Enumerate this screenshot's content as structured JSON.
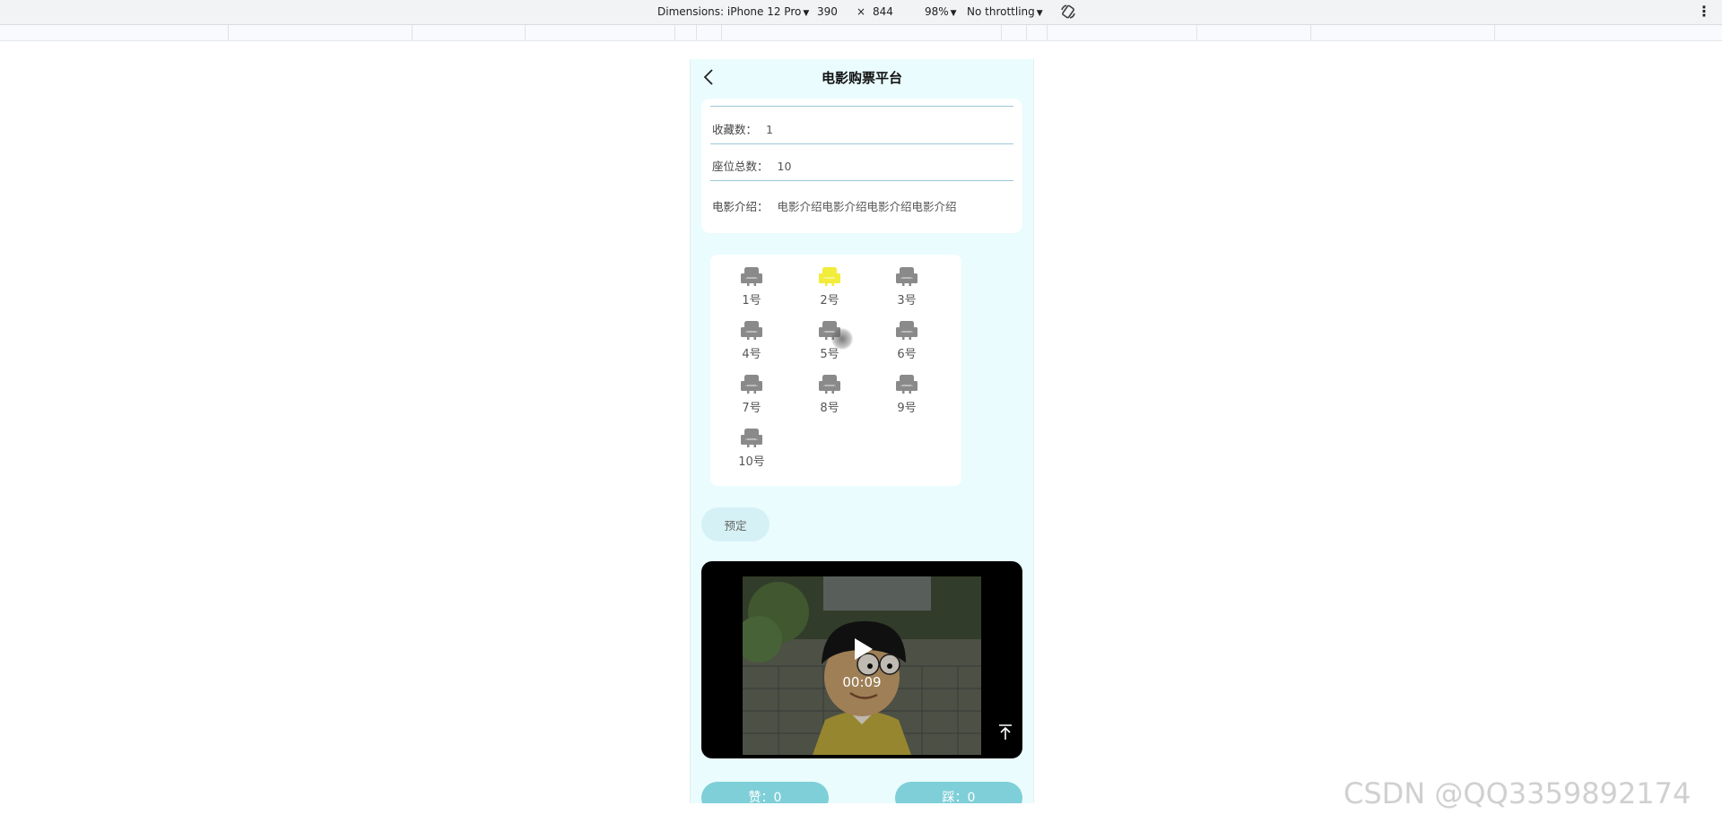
{
  "devtools": {
    "dimensions_label": "Dimensions: iPhone 12 Pro",
    "width": "390",
    "times": "×",
    "height": "844",
    "zoom": "98%",
    "throttling": "No throttling"
  },
  "app": {
    "title": "电影购票平台"
  },
  "info": {
    "favorites_label": "收藏数：",
    "favorites_value": "1",
    "seats_total_label": "座位总数：",
    "seats_total_value": "10",
    "intro_label": "电影介绍：",
    "intro_value": "电影介绍电影介绍电影介绍电影介绍"
  },
  "seats": [
    {
      "label": "1号",
      "selected": false
    },
    {
      "label": "2号",
      "selected": true
    },
    {
      "label": "3号",
      "selected": false
    },
    {
      "label": "4号",
      "selected": false
    },
    {
      "label": "5号",
      "selected": false
    },
    {
      "label": "6号",
      "selected": false
    },
    {
      "label": "7号",
      "selected": false
    },
    {
      "label": "8号",
      "selected": false
    },
    {
      "label": "9号",
      "selected": false
    },
    {
      "label": "10号",
      "selected": false
    }
  ],
  "colors": {
    "seat_default": "#8a8a8a",
    "seat_selected": "#f2ec3a"
  },
  "reserve_button": "预定",
  "video": {
    "time": "00:09"
  },
  "actions": {
    "like": "赞：0",
    "dislike": "踩：0"
  },
  "watermark": "CSDN @QQ3359892174"
}
